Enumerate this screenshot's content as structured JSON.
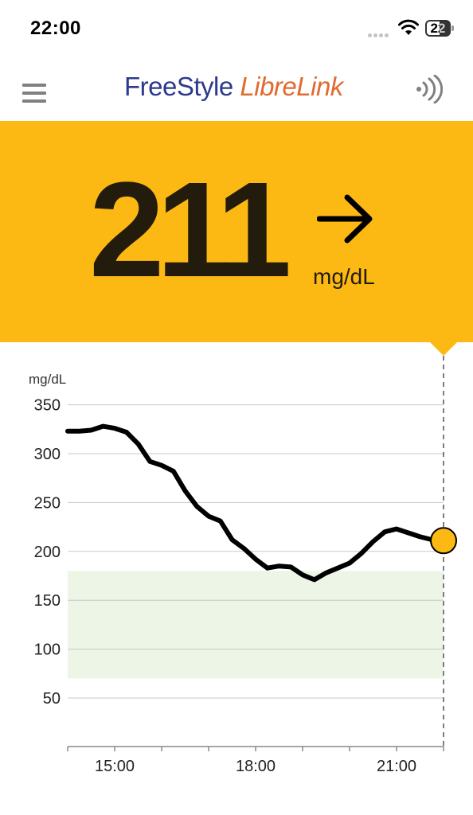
{
  "status_bar": {
    "time": "22:00",
    "battery_level": "22",
    "icons": [
      "signal-dots-icon",
      "wifi-icon",
      "battery-icon"
    ]
  },
  "header": {
    "brand_primary": "FreeStyle",
    "brand_secondary": "LibreLink",
    "menu_icon": "hamburger-menu-icon",
    "scan_icon": "nfc-scan-icon"
  },
  "reading": {
    "value": "211",
    "unit": "mg/dL",
    "trend": "steady-right-arrow"
  },
  "colors": {
    "panel": "#fdb913",
    "target_range": "#edf6e6",
    "line": "#000000",
    "current_point": "#fdb913",
    "brand_blue": "#2c3a8c",
    "brand_orange": "#e06b30"
  },
  "chart_data": {
    "type": "line",
    "ylabel": "mg/dL",
    "yticks": [
      50,
      100,
      150,
      200,
      250,
      300,
      350
    ],
    "xticks": [
      "15:00",
      "18:00",
      "21:00"
    ],
    "x_range": [
      "14:00",
      "22:00"
    ],
    "target_range": [
      70,
      180
    ],
    "grid": true,
    "series": [
      {
        "x": [
          "14:00",
          "14:15",
          "14:30",
          "14:45",
          "15:00",
          "15:15",
          "15:30",
          "15:45",
          "16:00",
          "16:15",
          "16:30",
          "16:45",
          "17:00",
          "17:15",
          "17:30",
          "17:45",
          "18:00",
          "18:15",
          "18:30",
          "18:45",
          "19:00",
          "19:15",
          "19:30",
          "19:45",
          "20:00",
          "20:15",
          "20:30",
          "20:45",
          "21:00",
          "21:15",
          "21:30",
          "21:45",
          "22:00"
        ],
        "y": [
          323,
          323,
          324,
          328,
          326,
          322,
          310,
          292,
          288,
          282,
          262,
          246,
          236,
          231,
          212,
          203,
          192,
          183,
          185,
          184,
          176,
          171,
          178,
          183,
          188,
          198,
          210,
          220,
          223,
          219,
          215,
          212,
          211
        ]
      }
    ],
    "current_point": {
      "x": "22:00",
      "y": 211
    }
  }
}
